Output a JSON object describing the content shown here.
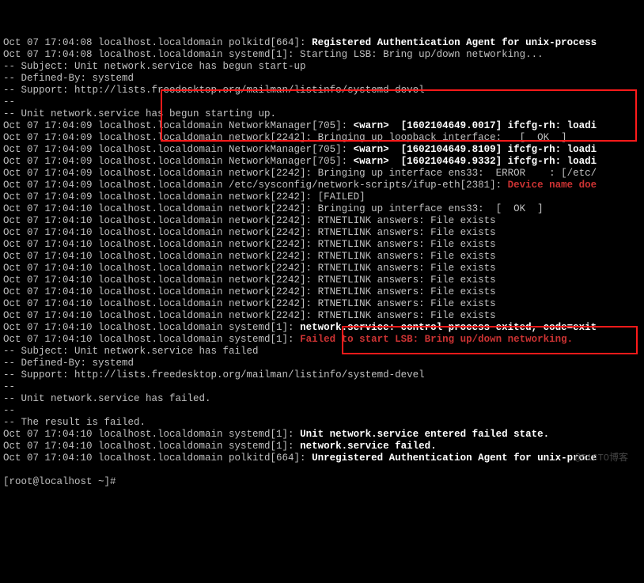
{
  "lines": [
    {
      "prefix": "Oct 07 17:04:08 localhost.localdomain polkitd[664]: ",
      "msg": "Registered Authentication Agent for unix-process",
      "msgClass": "bold-white"
    },
    {
      "prefix": "Oct 07 17:04:08 localhost.localdomain systemd[1]: Starting LSB: Bring up/down networking..."
    },
    {
      "prefix": "-- Subject: Unit network.service has begun start-up"
    },
    {
      "prefix": "-- Defined-By: systemd"
    },
    {
      "prefix": "-- Support: http://lists.freedesktop.org/mailman/listinfo/systemd-devel"
    },
    {
      "prefix": "--"
    },
    {
      "prefix": "-- Unit network.service has begun starting up."
    },
    {
      "prefix": "Oct 07 17:04:09 localhost.localdomain NetworkManager[705]: ",
      "msg": "<warn>  [1602104649.0017] ifcfg-rh: loadi",
      "msgClass": "bold-white"
    },
    {
      "prefix": "Oct 07 17:04:09 localhost.localdomain network[2242]: Bringing up loopback interface:   [  OK  ]"
    },
    {
      "prefix": "Oct 07 17:04:09 localhost.localdomain NetworkManager[705]: ",
      "msg": "<warn>  [1602104649.8109] ifcfg-rh: loadi",
      "msgClass": "bold-white"
    },
    {
      "prefix": "Oct 07 17:04:09 localhost.localdomain NetworkManager[705]: ",
      "msg": "<warn>  [1602104649.9332] ifcfg-rh: loadi",
      "msgClass": "bold-white"
    },
    {
      "prefix": "Oct 07 17:04:09 localhost.localdomain network[2242]: Bringing up interface ens33:  ERROR    : [/etc/"
    },
    {
      "prefix": "Oct 07 17:04:09 localhost.localdomain /etc/sysconfig/network-scripts/ifup-eth[2381]: ",
      "msg": "Device name doe",
      "msgClass": "red"
    },
    {
      "prefix": "Oct 07 17:04:09 localhost.localdomain network[2242]: [FAILED]"
    },
    {
      "prefix": "Oct 07 17:04:10 localhost.localdomain network[2242]: Bringing up interface ens33:  [  OK  ]"
    },
    {
      "prefix": "Oct 07 17:04:10 localhost.localdomain network[2242]: RTNETLINK answers: File exists"
    },
    {
      "prefix": "Oct 07 17:04:10 localhost.localdomain network[2242]: RTNETLINK answers: File exists"
    },
    {
      "prefix": "Oct 07 17:04:10 localhost.localdomain network[2242]: RTNETLINK answers: File exists"
    },
    {
      "prefix": "Oct 07 17:04:10 localhost.localdomain network[2242]: RTNETLINK answers: File exists"
    },
    {
      "prefix": "Oct 07 17:04:10 localhost.localdomain network[2242]: RTNETLINK answers: File exists"
    },
    {
      "prefix": "Oct 07 17:04:10 localhost.localdomain network[2242]: RTNETLINK answers: File exists"
    },
    {
      "prefix": "Oct 07 17:04:10 localhost.localdomain network[2242]: RTNETLINK answers: File exists"
    },
    {
      "prefix": "Oct 07 17:04:10 localhost.localdomain network[2242]: RTNETLINK answers: File exists"
    },
    {
      "prefix": "Oct 07 17:04:10 localhost.localdomain network[2242]: RTNETLINK answers: File exists"
    },
    {
      "prefix": "Oct 07 17:04:10 localhost.localdomain systemd[1]: ",
      "msg": "network.service: control process exited, code=exit",
      "msgClass": "bold-white"
    },
    {
      "prefix": "Oct 07 17:04:10 localhost.localdomain systemd[1]: ",
      "msg": "Failed to start LSB: Bring up/down networking.",
      "msgClass": "red"
    },
    {
      "prefix": "-- Subject: Unit network.service has failed"
    },
    {
      "prefix": "-- Defined-By: systemd"
    },
    {
      "prefix": "-- Support: http://lists.freedesktop.org/mailman/listinfo/systemd-devel"
    },
    {
      "prefix": "--"
    },
    {
      "prefix": "-- Unit network.service has failed."
    },
    {
      "prefix": "--"
    },
    {
      "prefix": "-- The result is failed."
    },
    {
      "prefix": "Oct 07 17:04:10 localhost.localdomain systemd[1]: ",
      "msg": "Unit network.service entered failed state.",
      "msgClass": "bold-white"
    },
    {
      "prefix": "Oct 07 17:04:10 localhost.localdomain systemd[1]: ",
      "msg": "network.service failed.",
      "msgClass": "bold-white"
    },
    {
      "prefix": "Oct 07 17:04:10 localhost.localdomain polkitd[664]: ",
      "msg": "Unregistered Authentication Agent for unix-proce",
      "msgClass": "bold-white"
    }
  ],
  "prompt": "[root@localhost ~]#",
  "watermark": "@51CTO博客"
}
